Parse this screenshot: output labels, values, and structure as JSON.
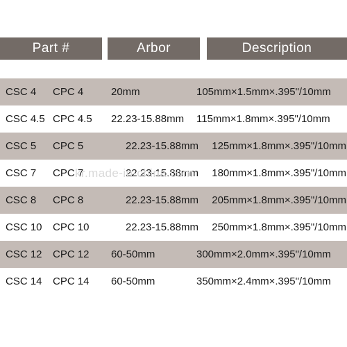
{
  "table": {
    "headers": {
      "part": "Part #",
      "arbor": "Arbor",
      "description": "Description"
    },
    "rows": [
      {
        "csc": "CSC 4",
        "cpc": "CPC 4",
        "arbor": "20mm",
        "description": "105mm×1.5mm×.395\"/10mm",
        "shaded": true
      },
      {
        "csc": "CSC 4.5",
        "cpc": "CPC 4.5",
        "arbor": "22.23-15.88mm",
        "description": "115mm×1.8mm×.395\"/10mm",
        "shaded": false
      },
      {
        "csc": "CSC 5",
        "cpc": "CPC 5",
        "arbor": "22.23-15.88mm",
        "description": "125mm×1.8mm×.395\"/10mm",
        "shaded": true
      },
      {
        "csc": "CSC 7",
        "cpc": "CPC 7",
        "arbor": "22.23-15.88mm",
        "description": "180mm×1.8mm×.395\"/10mm",
        "shaded": false
      },
      {
        "csc": "CSC 8",
        "cpc": "CPC 8",
        "arbor": "22.23-15.88mm",
        "description": "205mm×1.8mm×.395\"/10mm",
        "shaded": true
      },
      {
        "csc": "CSC 10",
        "cpc": "CPC 10",
        "arbor": "22.23-15.88mm",
        "description": "250mm×1.8mm×.395\"/10mm",
        "shaded": false
      },
      {
        "csc": "CSC 12",
        "cpc": "CPC 12",
        "arbor": "60-50mm",
        "description": "300mm×2.0mm×.395\"/10mm",
        "shaded": true
      },
      {
        "csc": "CSC 14",
        "cpc": "CPC 14",
        "arbor": "60-50mm",
        "description": "350mm×2.4mm×.395\"/10mm",
        "shaded": false
      }
    ]
  },
  "watermark": {
    "text": "kr.made-in-china.com"
  },
  "colors": {
    "header_background": "#736b66",
    "header_text": "#ffffff",
    "row_shaded": "#c4bbb6",
    "row_plain": "#ffffff",
    "body_text": "#1b1b1b",
    "watermark_text": "#d9d9d9"
  }
}
